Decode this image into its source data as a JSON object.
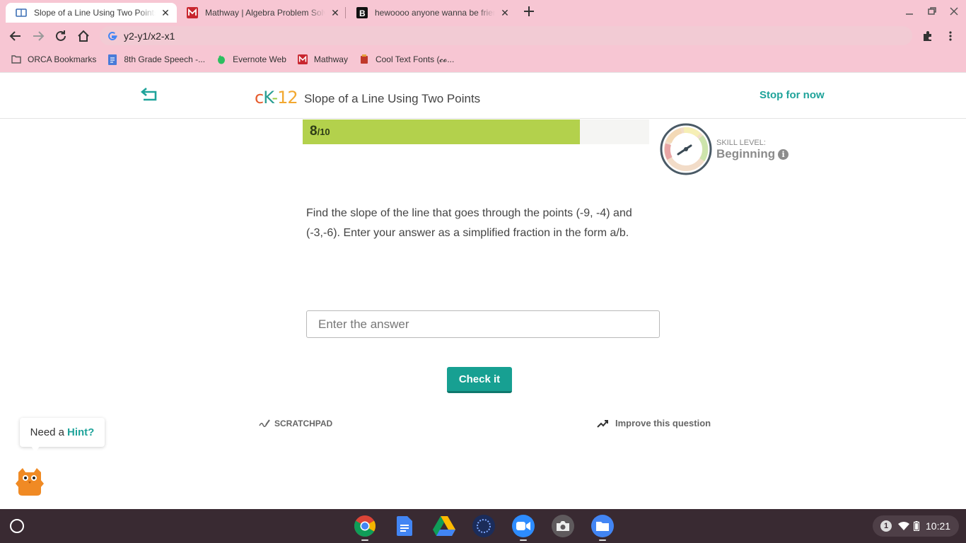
{
  "browser": {
    "tabs": [
      {
        "title": "Slope of a Line Using Two Points",
        "favicon": "ck12-book-icon",
        "active": true
      },
      {
        "title": "Mathway | Algebra Problem Solver",
        "favicon": "mathway-icon",
        "active": false
      },
      {
        "title": "hewoooo anyone wanna be friends",
        "favicon": "brainly-icon",
        "active": false
      }
    ],
    "close_glyph": "✕",
    "url": "y2-y1/x2-x1",
    "bookmarks": [
      {
        "label": "ORCA Bookmarks",
        "icon": "folder-icon"
      },
      {
        "label": "8th Grade Speech -...",
        "icon": "google-docs-icon"
      },
      {
        "label": "Evernote Web",
        "icon": "evernote-icon"
      },
      {
        "label": "Mathway",
        "icon": "mathway-icon"
      },
      {
        "label": "Cool Text Fonts (𝓬𝓸...",
        "icon": "cool-text-icon"
      }
    ]
  },
  "header": {
    "logo": {
      "c": "c",
      "k": "K",
      "dash": "-",
      "num": "12"
    },
    "title": "Slope of a Line Using Two Points",
    "stop_label": "Stop for now"
  },
  "progress": {
    "current": "8",
    "total": "/10",
    "fraction": 0.8
  },
  "skill": {
    "label": "SKILL LEVEL:",
    "value": "Beginning",
    "info_glyph": "i"
  },
  "question": {
    "text": "Find the slope of the line that goes through the points (-9, -4) and (-3,-6). Enter your answer as a simplified fraction in the form a/b."
  },
  "answer": {
    "placeholder": "Enter the answer",
    "value": ""
  },
  "check_label": "Check it",
  "tools": {
    "scratchpad": "SCRATCHPAD",
    "improve": "Improve this question"
  },
  "hint": {
    "prefix": "Need a",
    "link": "Hint?"
  },
  "shelf": {
    "apps": [
      "chrome-icon",
      "google-docs-icon",
      "google-drive-icon",
      "dots-app-icon",
      "zoom-icon",
      "camera-icon",
      "files-icon"
    ],
    "notification_count": "1",
    "time": "10:21"
  },
  "colors": {
    "chrome": "#f7c6d3",
    "accent": "#1fa39a",
    "progress_fill": "#b3d14c",
    "shelf": "#392a32"
  }
}
